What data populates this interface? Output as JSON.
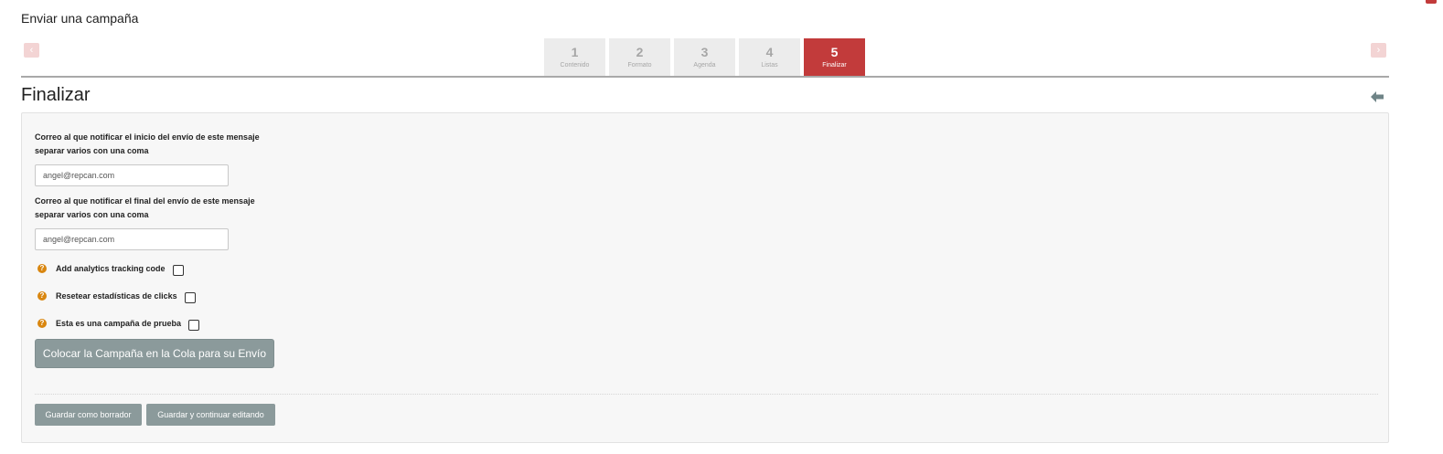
{
  "page": {
    "title": "Enviar una campaña"
  },
  "wizard": {
    "steps": [
      {
        "number": "1",
        "label": "Contenido"
      },
      {
        "number": "2",
        "label": "Formato"
      },
      {
        "number": "3",
        "label": "Agenda"
      },
      {
        "number": "4",
        "label": "Listas"
      },
      {
        "number": "5",
        "label": "Finalizar"
      }
    ],
    "active_step": "5",
    "prev_icon": "chevron-left-icon",
    "next_icon": "chevron-right-icon"
  },
  "section": {
    "title": "Finalizar",
    "back_icon": "arrow-left-icon"
  },
  "form": {
    "notify_start": {
      "label_line1": "Correo al que notificar el inicio del envío de este mensaje",
      "label_line2": "separar varios con una coma",
      "value": "angel@repcan.com"
    },
    "notify_end": {
      "label_line1": "Correo al que notificar el final del envío de este mensaje",
      "label_line2": "separar varios con una coma",
      "value": "angel@repcan.com"
    },
    "options": [
      {
        "label": "Add analytics tracking code",
        "checked": false
      },
      {
        "label": "Resetear estadísticas de clicks",
        "checked": false
      },
      {
        "label": "Esta es una campaña de prueba",
        "checked": false
      }
    ],
    "help_icon": "?",
    "submit_label": "Colocar la Campaña en la Cola para su Envío",
    "save_draft_label": "Guardar como borrador",
    "save_continue_label": "Guardar y continuar editando"
  },
  "colors": {
    "accent": "#c23b3b",
    "button": "#8b9a9b",
    "help": "#d9860f",
    "step_inactive": "#ececec"
  }
}
